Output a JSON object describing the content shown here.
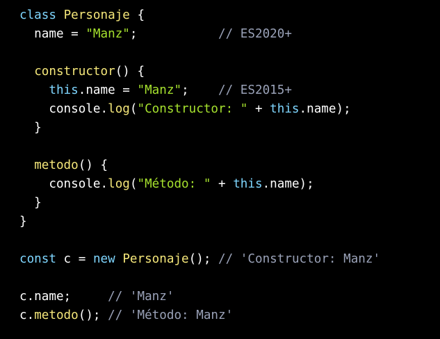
{
  "colors": {
    "background": "#000000",
    "keyword": "#7fd6ff",
    "class_name": "#f5e77a",
    "string": "#a6e22e",
    "function": "#f5e77a",
    "comment": "#9aa2b8",
    "plain": "#ffffff"
  },
  "code": {
    "lines": [
      [
        {
          "t": "class",
          "k": "kw"
        },
        {
          "t": " ",
          "k": "plain"
        },
        {
          "t": "Personaje",
          "k": "cls"
        },
        {
          "t": " {",
          "k": "plain"
        }
      ],
      [
        {
          "t": "  name = ",
          "k": "plain"
        },
        {
          "t": "\"Manz\"",
          "k": "str"
        },
        {
          "t": ";           ",
          "k": "plain"
        },
        {
          "t": "// ES2020+",
          "k": "cm"
        }
      ],
      [],
      [
        {
          "t": "  ",
          "k": "plain"
        },
        {
          "t": "constructor",
          "k": "fn"
        },
        {
          "t": "() {",
          "k": "plain"
        }
      ],
      [
        {
          "t": "    ",
          "k": "plain"
        },
        {
          "t": "this",
          "k": "kw"
        },
        {
          "t": ".name = ",
          "k": "plain"
        },
        {
          "t": "\"Manz\"",
          "k": "str"
        },
        {
          "t": ";    ",
          "k": "plain"
        },
        {
          "t": "// ES2015+",
          "k": "cm"
        }
      ],
      [
        {
          "t": "    console.",
          "k": "plain"
        },
        {
          "t": "log",
          "k": "fn"
        },
        {
          "t": "(",
          "k": "plain"
        },
        {
          "t": "\"Constructor: \"",
          "k": "str"
        },
        {
          "t": " + ",
          "k": "plain"
        },
        {
          "t": "this",
          "k": "kw"
        },
        {
          "t": ".name);",
          "k": "plain"
        }
      ],
      [
        {
          "t": "  }",
          "k": "plain"
        }
      ],
      [],
      [
        {
          "t": "  ",
          "k": "plain"
        },
        {
          "t": "metodo",
          "k": "fn"
        },
        {
          "t": "() {",
          "k": "plain"
        }
      ],
      [
        {
          "t": "    console.",
          "k": "plain"
        },
        {
          "t": "log",
          "k": "fn"
        },
        {
          "t": "(",
          "k": "plain"
        },
        {
          "t": "\"Método: \"",
          "k": "str"
        },
        {
          "t": " + ",
          "k": "plain"
        },
        {
          "t": "this",
          "k": "kw"
        },
        {
          "t": ".name);",
          "k": "plain"
        }
      ],
      [
        {
          "t": "  }",
          "k": "plain"
        }
      ],
      [
        {
          "t": "}",
          "k": "plain"
        }
      ],
      [],
      [
        {
          "t": "const",
          "k": "kw"
        },
        {
          "t": " c = ",
          "k": "plain"
        },
        {
          "t": "new",
          "k": "kw"
        },
        {
          "t": " ",
          "k": "plain"
        },
        {
          "t": "Personaje",
          "k": "cls"
        },
        {
          "t": "(); ",
          "k": "plain"
        },
        {
          "t": "// 'Constructor: Manz'",
          "k": "cm"
        }
      ],
      [],
      [
        {
          "t": "c.name;     ",
          "k": "plain"
        },
        {
          "t": "// 'Manz'",
          "k": "cm"
        }
      ],
      [
        {
          "t": "c.",
          "k": "plain"
        },
        {
          "t": "metodo",
          "k": "fn"
        },
        {
          "t": "(); ",
          "k": "plain"
        },
        {
          "t": "// 'Método: Manz'",
          "k": "cm"
        }
      ]
    ]
  }
}
